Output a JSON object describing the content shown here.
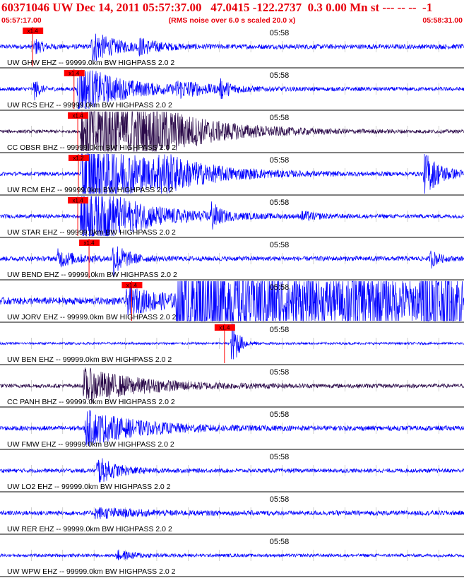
{
  "header": {
    "title": "60371046 UW Dec 14, 2011 05:57:37.00   47.0415 -122.2737  0.3 0.00 Mn st --- -- --  -1",
    "start_time": "05:57:17.00",
    "scale_note": "(RMS noise over 6.0 s scaled 20.0 x)",
    "end_time": "05:58:31.00"
  },
  "colors": {
    "trace_blue": "#0000ff",
    "trace_dark": "#2b0a4a",
    "header_red": "#e8000b",
    "pick_red": "#ff0000",
    "divider": "#000000"
  },
  "chart_data": {
    "type": "line",
    "x_start": "05:57:17.00",
    "x_end": "05:58:31.00",
    "x_tick_label": "05:58",
    "grid": true,
    "traces": [
      {
        "label": "UW GHW EHZ -- 99999.0km BW  HIGHPASS  2.0  2",
        "pick": "x1.4",
        "pick_sec": 5.2,
        "color": "blue",
        "noise": 0.12,
        "bursts": [
          {
            "t": 5.4,
            "a": 0.45,
            "d": 1.2
          },
          {
            "t": 14.5,
            "a": 0.85,
            "d": 3.5
          },
          {
            "t": 22,
            "a": 0.35,
            "d": 3
          }
        ]
      },
      {
        "label": "UW RCS EHZ -- 99999.0km BW  HIGHPASS  2.0  2",
        "pick": "x1.4",
        "pick_sec": 11.8,
        "color": "blue",
        "noise": 0.1,
        "bursts": [
          {
            "t": 5.3,
            "a": 0.7,
            "d": 0.8
          },
          {
            "t": 12.2,
            "a": 1.3,
            "d": 7
          },
          {
            "t": 28,
            "a": 0.4,
            "d": 4
          },
          {
            "t": 35,
            "a": 0.45,
            "d": 1.5
          }
        ]
      },
      {
        "label": "CC OBSR BHZ -- 99999.0km BW  HIGHPASS  2.0  2",
        "pick": "x1.4",
        "pick_sec": 12.4,
        "color": "dark",
        "noise": 0.08,
        "bursts": [
          {
            "t": 12.8,
            "a": 3.0,
            "d": 10
          },
          {
            "t": 24,
            "a": 0.5,
            "d": 8
          }
        ]
      },
      {
        "label": "UW RCM EHZ -- 99999.0km BW  HIGHPASS  2.0  2",
        "pick": "x1.2",
        "pick_sec": 12.5,
        "color": "blue",
        "noise": 0.1,
        "bursts": [
          {
            "t": 12.9,
            "a": 2.5,
            "d": 9
          },
          {
            "t": 25,
            "a": 0.6,
            "d": 6
          },
          {
            "t": 67.5,
            "a": 1.2,
            "d": 2.5
          }
        ]
      },
      {
        "label": "UW STAR EHZ -- 99999.0km BW  HIGHPASS  2.0  2",
        "pick": "x1.4",
        "pick_sec": 12.4,
        "color": "blue",
        "noise": 0.1,
        "bursts": [
          {
            "t": 12.8,
            "a": 2.0,
            "d": 8
          },
          {
            "t": 33.5,
            "a": 0.8,
            "d": 1.2
          },
          {
            "t": 48,
            "a": 0.25,
            "d": 2
          }
        ]
      },
      {
        "label": "UW BEND EHZ -- 99999.0km BW  HIGHPASS  2.0  2",
        "pick": "x1.4",
        "pick_sec": 14.2,
        "color": "blue",
        "noise": 0.12,
        "bursts": [
          {
            "t": 9,
            "a": 0.45,
            "d": 3
          },
          {
            "t": 17.8,
            "a": 1.0,
            "d": 2
          },
          {
            "t": 68.5,
            "a": 0.5,
            "d": 1.2
          }
        ]
      },
      {
        "label": "UW JORV EHZ -- 99999.0km BW  HIGHPASS  2.0  2",
        "pick": "x1.4",
        "pick_sec": 21.0,
        "color": "blue",
        "noise": 0.18,
        "bursts": [
          {
            "t": 20,
            "a": 0.6,
            "d": 8
          },
          {
            "t": 28,
            "a": 2.5,
            "d": 26
          },
          {
            "t": 55,
            "a": 0.8,
            "d": 10
          },
          {
            "t": 67,
            "a": 1.8,
            "d": 7
          }
        ]
      },
      {
        "label": "UW BEN EHZ -- 99999.0km BW  HIGHPASS  2.0  2",
        "pick": "x1.4",
        "pick_sec": 35.8,
        "color": "blue",
        "noise": 0.06,
        "bursts": [
          {
            "t": 36.8,
            "a": 1.8,
            "d": 1.0
          }
        ]
      },
      {
        "label": "CC PANH BHZ -- 99999.0km BW  HIGHPASS  2.0  2",
        "pick": "",
        "pick_sec": null,
        "color": "dark",
        "noise": 0.1,
        "bursts": [
          {
            "t": 13.2,
            "a": 0.9,
            "d": 9
          }
        ]
      },
      {
        "label": "UW FMW EHZ -- 99999.0km BW  HIGHPASS  2.0  2",
        "pick": "",
        "pick_sec": null,
        "color": "blue",
        "noise": 0.12,
        "bursts": [
          {
            "t": 13.5,
            "a": 0.9,
            "d": 8
          }
        ]
      },
      {
        "label": "UW LO2 EHZ -- 99999.0km BW  HIGHPASS  2.0  2",
        "pick": "",
        "pick_sec": null,
        "color": "blue",
        "noise": 0.1,
        "bursts": [
          {
            "t": 15.3,
            "a": 0.75,
            "d": 3
          }
        ]
      },
      {
        "label": "UW RER EHZ -- 99999.0km BW  HIGHPASS  2.0  2",
        "pick": "",
        "pick_sec": null,
        "color": "blue",
        "noise": 0.12,
        "bursts": [
          {
            "t": 15,
            "a": 0.25,
            "d": 6
          }
        ]
      },
      {
        "label": "UW WPW EHZ -- 99999.0km BW  HIGHPASS  2.0  2",
        "pick": "",
        "pick_sec": null,
        "color": "blue",
        "noise": 0.08,
        "bursts": [
          {
            "t": 18.5,
            "a": 0.25,
            "d": 3
          }
        ]
      }
    ]
  }
}
